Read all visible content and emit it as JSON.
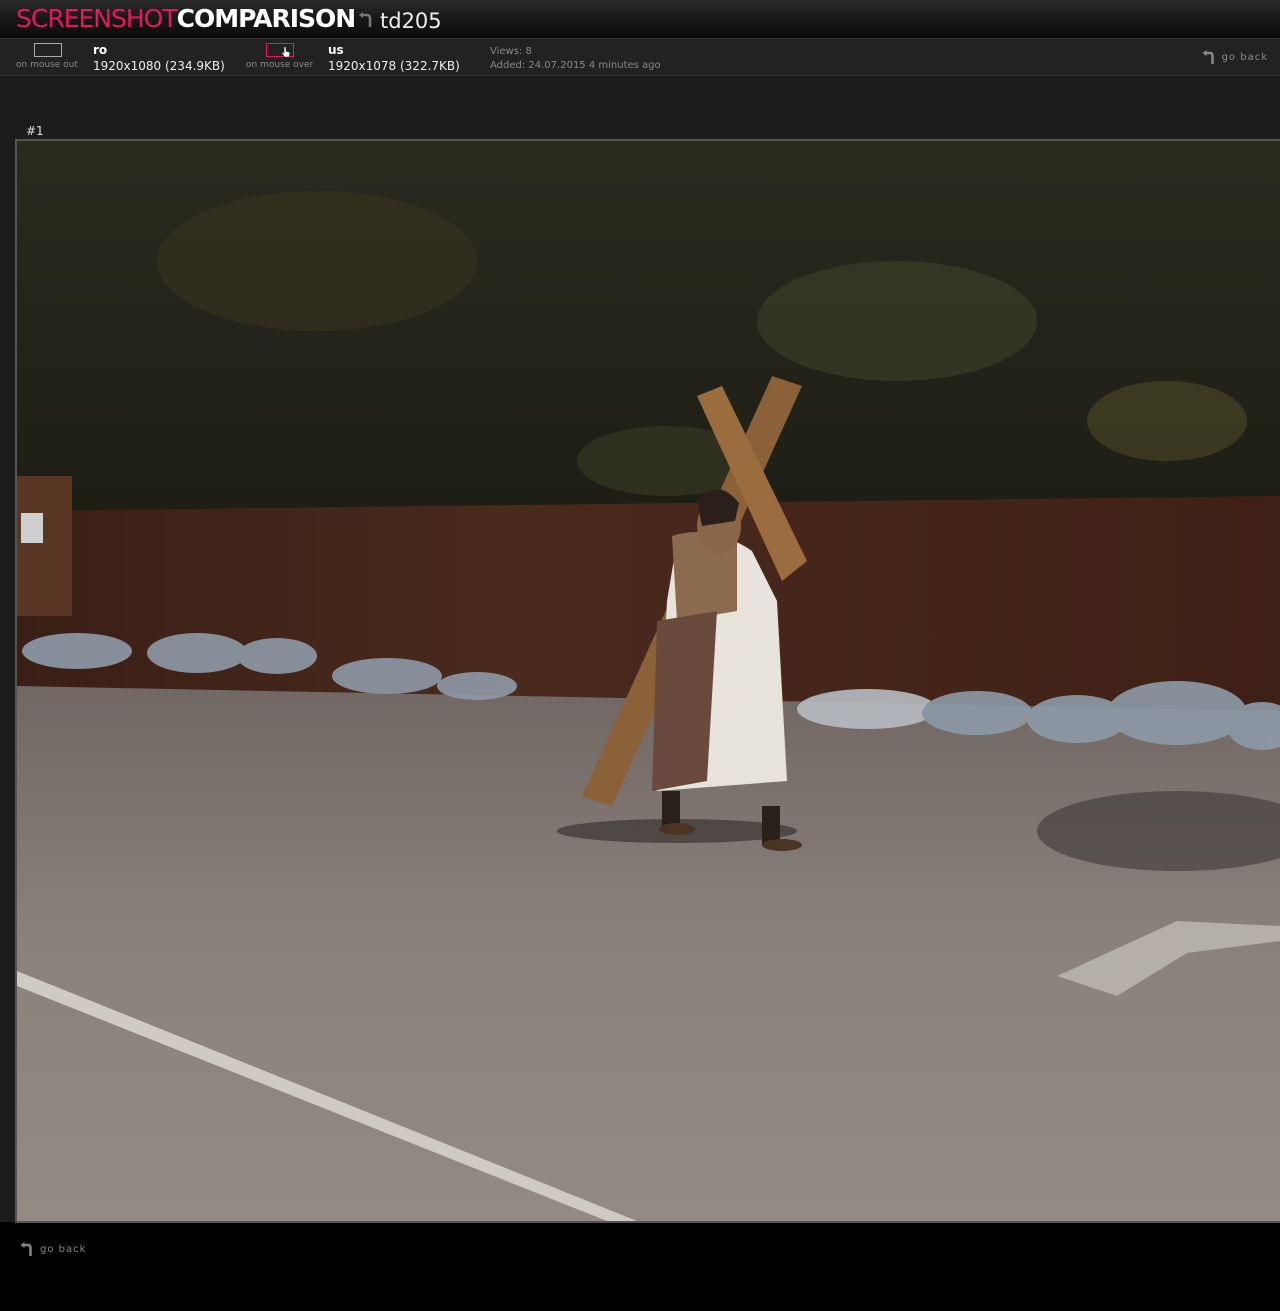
{
  "header": {
    "logo_part1": "SCREENSHOT",
    "logo_part2": "COMPARISON",
    "comparison_title": "td205"
  },
  "infobar": {
    "mode_out_label": "on mouse out",
    "mode_over_label": "on mouse over",
    "version_a": {
      "name": "ro",
      "info": "1920x1080 (234.9KB)"
    },
    "version_b": {
      "name": "us",
      "info": "1920x1078 (322.7KB)"
    },
    "views_text": "Views:  8",
    "added_text": "Added:  24.07.2015 4 minutes ago",
    "go_back": "go back"
  },
  "screenshots": [
    {
      "label": "#1"
    }
  ],
  "footer": {
    "go_back": "go back"
  },
  "colors": {
    "accent": "#e8175d",
    "background": "#000000",
    "panel": "#222222"
  },
  "icons": {
    "back": "hook-arrow-icon",
    "cursor": "hand-cursor-icon"
  }
}
